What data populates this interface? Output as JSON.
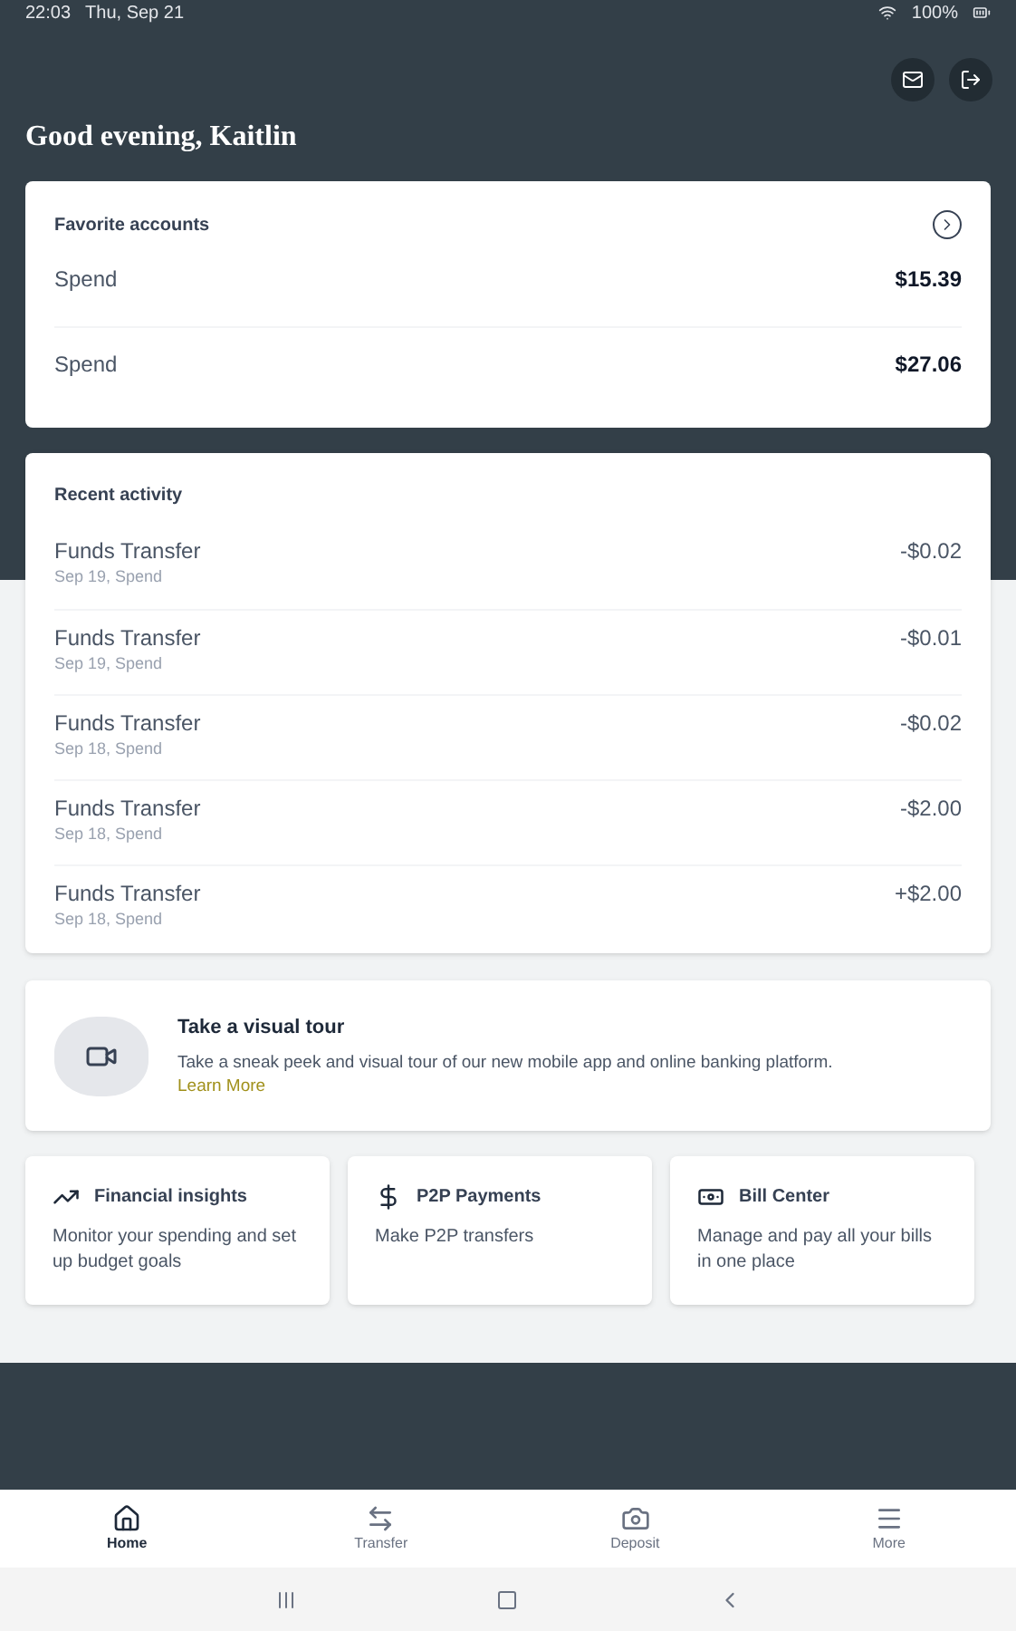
{
  "status_bar": {
    "time": "22:03",
    "date": "Thu, Sep 21",
    "battery": "100%"
  },
  "greeting": "Good evening, Kaitlin",
  "favorite_accounts": {
    "title": "Favorite accounts",
    "accounts": [
      {
        "name": "Spend",
        "balance": "$15.39"
      },
      {
        "name": "Spend",
        "balance": "$27.06"
      }
    ]
  },
  "recent_activity": {
    "title": "Recent activity",
    "items": [
      {
        "title": "Funds Transfer",
        "subtitle": "Sep 19, Spend",
        "amount": "-$0.02"
      },
      {
        "title": "Funds Transfer",
        "subtitle": "Sep 19, Spend",
        "amount": "-$0.01"
      },
      {
        "title": "Funds Transfer",
        "subtitle": "Sep 18, Spend",
        "amount": "-$0.02"
      },
      {
        "title": "Funds Transfer",
        "subtitle": "Sep 18, Spend",
        "amount": "-$2.00"
      },
      {
        "title": "Funds Transfer",
        "subtitle": "Sep 18, Spend",
        "amount": "+$2.00"
      }
    ]
  },
  "tour": {
    "title": "Take a visual tour",
    "text": "Take a sneak peek and visual tour of our new mobile app and online banking platform.",
    "link": "Learn More"
  },
  "tiles": [
    {
      "kind": "insights",
      "title": "Financial insights",
      "text": "Monitor your spending and set up budget goals"
    },
    {
      "kind": "p2p",
      "title": "P2P Payments",
      "text": "Make P2P transfers"
    },
    {
      "kind": "bills",
      "title": "Bill Center",
      "text": "Manage and pay all your bills in one place"
    }
  ],
  "bottom_nav": [
    {
      "kind": "home",
      "label": "Home",
      "selected": true
    },
    {
      "kind": "transfer",
      "label": "Transfer",
      "selected": false
    },
    {
      "kind": "deposit",
      "label": "Deposit",
      "selected": false
    },
    {
      "kind": "more",
      "label": "More",
      "selected": false
    }
  ]
}
